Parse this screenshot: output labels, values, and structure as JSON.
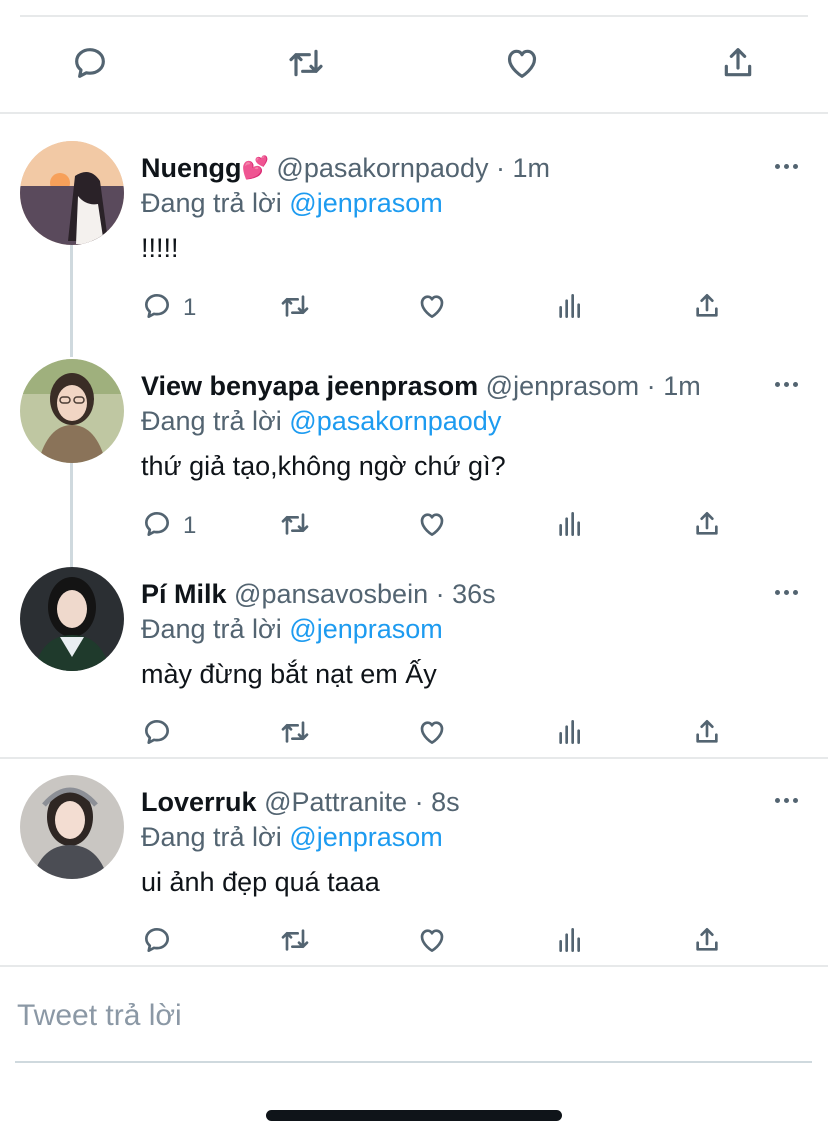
{
  "main_tweet_actions": [
    {
      "name": "reply-icon",
      "icon": "comment"
    },
    {
      "name": "retweet-icon",
      "icon": "retweet"
    },
    {
      "name": "like-icon",
      "icon": "heart"
    },
    {
      "name": "share-icon",
      "icon": "share"
    }
  ],
  "replies": [
    {
      "name": "Nuengg",
      "emoji": "💕",
      "handle": "@pasakornpaody",
      "separator": "·",
      "time": "1m",
      "reply_prefix": "Đang trả lời",
      "mention": "@jenprasom",
      "text": "!!!!!",
      "reply_count": "1",
      "avatar_colors": [
        "#f2b27a",
        "#5a4a5c"
      ]
    },
    {
      "name": "View benyapa jeenprasom",
      "emoji": "",
      "handle": "@jenprasom",
      "separator": "·",
      "time": "1m",
      "reply_prefix": "Đang trả lời",
      "mention": "@pasakornpaody",
      "text": "thứ giả tạo,không ngờ chứ gì?",
      "reply_count": "1",
      "avatar_colors": [
        "#a7b88d",
        "#6b5c4a"
      ]
    },
    {
      "name": "Pí Milk",
      "emoji": "",
      "handle": "@pansavosbein",
      "separator": "·",
      "time": "36s",
      "reply_prefix": "Đang trả lời",
      "mention": "@jenprasom",
      "text": "mày đừng bắt nạt em Ấy",
      "reply_count": "",
      "avatar_colors": [
        "#2b2f33",
        "#1f3a2c"
      ]
    },
    {
      "name": "Loverruk",
      "emoji": "",
      "handle": "@Pattranite",
      "separator": "·",
      "time": "8s",
      "reply_prefix": "Đang trả lời",
      "mention": "@jenprasom",
      "text": "ui ảnh đẹp quá taaa",
      "reply_count": "",
      "avatar_colors": [
        "#c9c6c2",
        "#4b4d54"
      ]
    }
  ],
  "composer": {
    "placeholder": "Tweet trả lời"
  },
  "colors": {
    "link": "#1d9bf0",
    "secondary_text": "#536471",
    "primary_text": "#0f1419",
    "divider": "#e7e9ea"
  }
}
